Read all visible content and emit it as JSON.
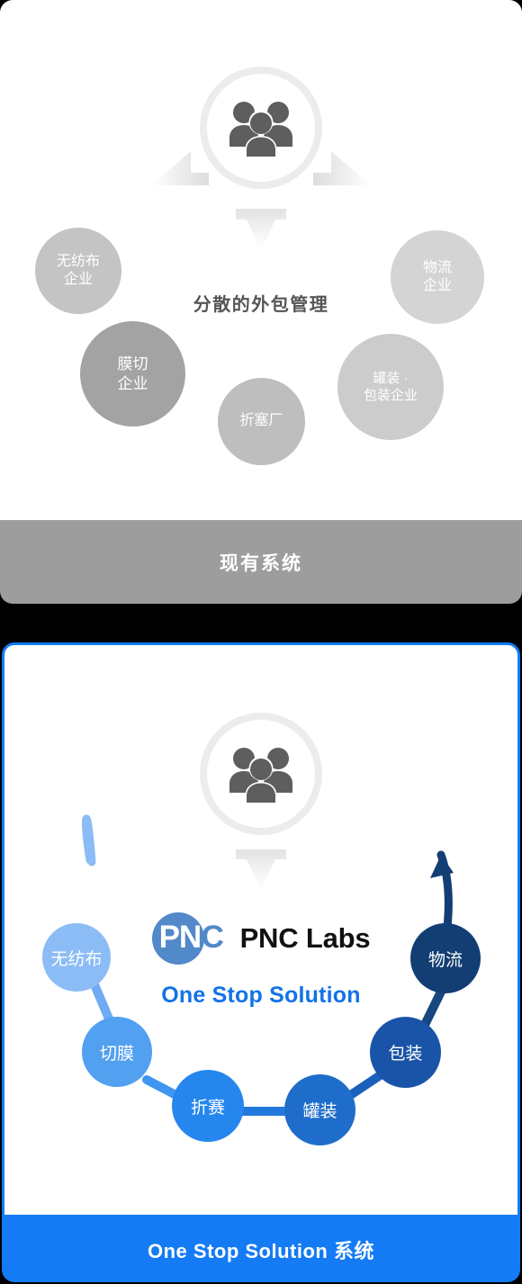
{
  "top_section": {
    "center_title": "分散的外包管理",
    "people_icon": "people-group-icon",
    "bubbles": [
      {
        "label_line1": "无纺布",
        "label_line2": "企业",
        "color": "#c4c4c4"
      },
      {
        "label_line1": "膜切",
        "label_line2": "企业",
        "color": "#a3a3a3"
      },
      {
        "label_line1": "折塞厂",
        "label_line2": "",
        "color": "#bebebe"
      },
      {
        "label_line1": "罐装 ·",
        "label_line2": "包装企业",
        "color": "#cccccc"
      },
      {
        "label_line1": "物流",
        "label_line2": "企业",
        "color": "#d4d4d4"
      }
    ]
  },
  "gray_banner": {
    "label": "现有系统",
    "color": "#9d9d9d"
  },
  "bottom_section": {
    "people_icon": "people-group-icon",
    "logo": {
      "mark_primary": "PN",
      "mark_secondary": "C",
      "wordmark": "PNC Labs",
      "tagline": "One Stop Solution",
      "mark_color": "#5189c9",
      "tagline_color": "#1273e6"
    },
    "chain_nodes": [
      {
        "label": "无纺布",
        "color": "#8cbcf5"
      },
      {
        "label": "切膜",
        "color": "#52a0f0"
      },
      {
        "label": "折赛",
        "color": "#2586ee"
      },
      {
        "label": "罐装",
        "color": "#1f6dcb"
      },
      {
        "label": "包装",
        "color": "#1a54a8"
      },
      {
        "label": "物流",
        "color": "#133e73"
      }
    ]
  },
  "blue_banner": {
    "label": "One Stop Solution 系统",
    "color": "#147bf4"
  }
}
